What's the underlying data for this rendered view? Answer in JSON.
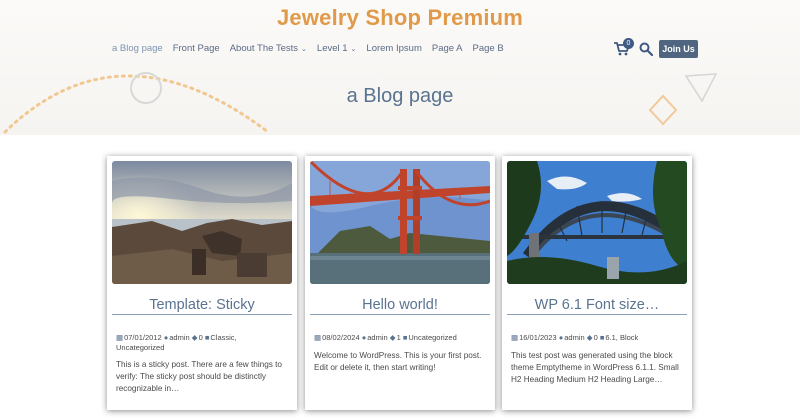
{
  "site": {
    "title": "Jewelry Shop Premium",
    "page_title": "a Blog page"
  },
  "nav": {
    "items": [
      {
        "label": "a Blog page",
        "active": true,
        "has_caret": false
      },
      {
        "label": "Front Page",
        "active": false,
        "has_caret": false
      },
      {
        "label": "About The Tests",
        "active": false,
        "has_caret": true
      },
      {
        "label": "Level 1",
        "active": false,
        "has_caret": true
      },
      {
        "label": "Lorem Ipsum",
        "active": false,
        "has_caret": false
      },
      {
        "label": "Page A",
        "active": false,
        "has_caret": false
      },
      {
        "label": "Page B",
        "active": false,
        "has_caret": false
      }
    ],
    "caret": "⌄"
  },
  "header_actions": {
    "cart_count": "0",
    "join_label": "Join Us",
    "cart_icon": "cart-icon",
    "search_icon": "search-icon"
  },
  "colors": {
    "accent_orange": "#e09a4a",
    "nav_blue": "#5a6b86",
    "button_blue": "#4f6580",
    "title_blue": "#5a7390"
  },
  "posts": [
    {
      "title": "Template: Sticky",
      "date": "07/01/2012",
      "author": "admin",
      "comments": "0",
      "categories": "Classic,",
      "categories_line2": "Uncategorized",
      "excerpt": "This is a sticky post. There are a few things to verify: The sticky post should be distinctly recognizable in…",
      "image": "rocky-beach-sunset"
    },
    {
      "title": "Hello world!",
      "date": "08/02/2024",
      "author": "admin",
      "comments": "1",
      "categories": "Uncategorized",
      "categories_line2": "",
      "excerpt": "Welcome to WordPress. This is your first post. Edit or delete it, then start writing!",
      "image": "golden-gate-bridge"
    },
    {
      "title": "WP 6.1 Font size…",
      "date": "16/01/2023",
      "author": "admin",
      "comments": "0",
      "categories": "6.1, Block",
      "categories_line2": "",
      "excerpt": "This test post was generated using the block theme Emptytheme in WordPress 6.1.1. Small H2 Heading Medium H2 Heading Large…",
      "image": "harbour-bridge"
    }
  ]
}
